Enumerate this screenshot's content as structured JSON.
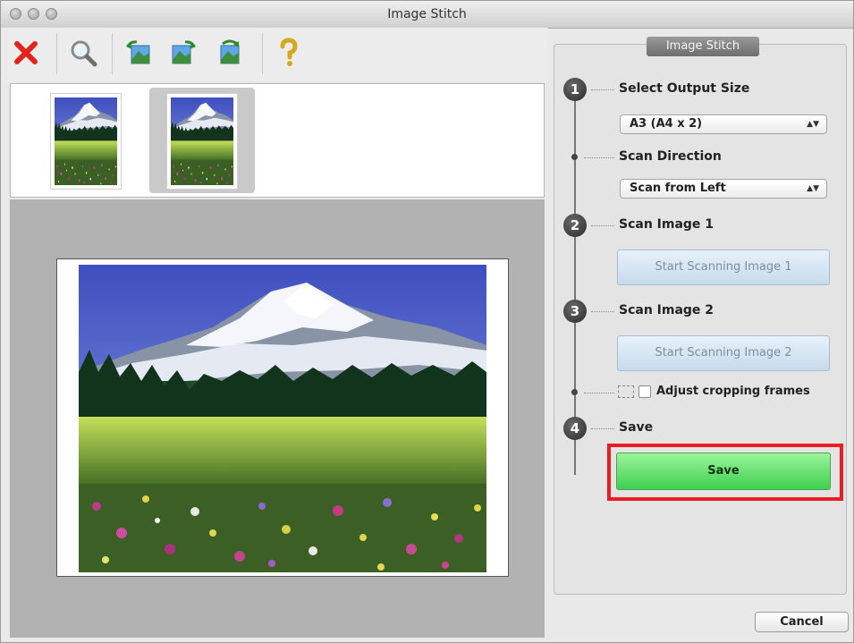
{
  "window": {
    "title": "Image Stitch"
  },
  "toolbar": {
    "items": [
      {
        "name": "delete",
        "icon": "red-x-icon"
      },
      {
        "name": "zoom",
        "icon": "magnifier-icon"
      },
      {
        "name": "rotate-left",
        "icon": "rotate-left-image-icon"
      },
      {
        "name": "rotate-right",
        "icon": "rotate-right-image-icon"
      },
      {
        "name": "rotate-180",
        "icon": "rotate-180-image-icon"
      },
      {
        "name": "help",
        "icon": "question-mark-icon"
      }
    ]
  },
  "panel": {
    "title": "Image Stitch",
    "steps": [
      {
        "number": "1",
        "label": "Select Output Size"
      },
      {
        "number": "2",
        "label": "Scan Image 1"
      },
      {
        "number": "3",
        "label": "Scan Image 2"
      },
      {
        "number": "4",
        "label": "Save"
      }
    ],
    "output_size": {
      "selected": "A3 (A4 x 2)"
    },
    "scan_direction": {
      "label": "Scan Direction",
      "selected": "Scan from Left"
    },
    "scan_image_1_button": "Start Scanning Image 1",
    "scan_image_2_button": "Start Scanning Image 2",
    "adjust_cropping": {
      "label": "Adjust cropping frames",
      "checked": false
    },
    "save_button": "Save"
  },
  "footer": {
    "cancel_button": "Cancel"
  },
  "colors": {
    "highlight": "#ea1c24",
    "save_green": "#3fcf51",
    "delete_red": "#e0261c"
  }
}
